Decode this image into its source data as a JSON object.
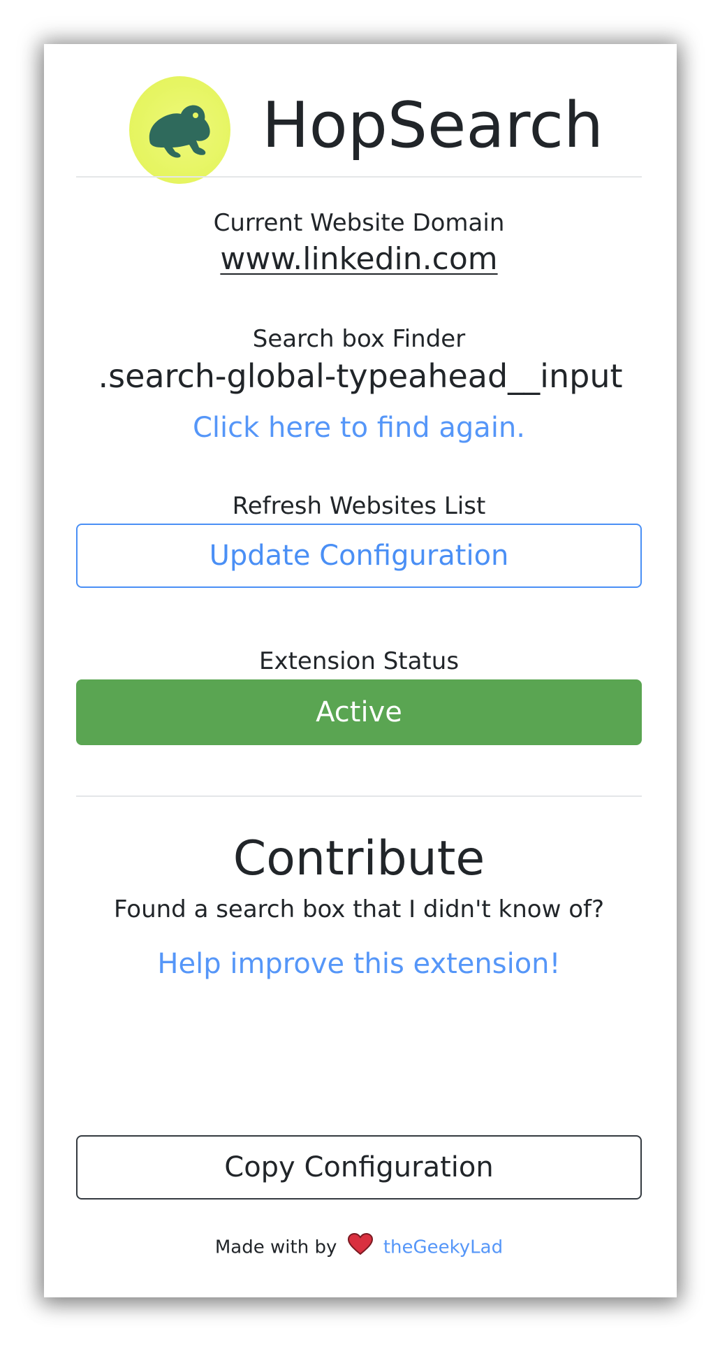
{
  "header": {
    "logo_icon": "frog-icon",
    "title": "HopSearch"
  },
  "domain": {
    "label": "Current Website Domain",
    "value": "www.linkedin.com"
  },
  "finder": {
    "label": "Search box Finder",
    "value": ".search-global-typeahead__input",
    "find_again_link": "Click here to find again."
  },
  "refresh": {
    "label": "Refresh Websites List",
    "button_label": "Update Configuration"
  },
  "status": {
    "label": "Extension Status",
    "value": "Active",
    "color": "#5aa552"
  },
  "contribute": {
    "heading": "Contribute",
    "prompt": "Found a search box that I didn't know of?",
    "help_link": "Help improve this extension!",
    "copy_button_label": "Copy Configuration"
  },
  "footer": {
    "made_with": "Made with",
    "by": "by",
    "heart_icon": "heart-icon",
    "author": "theGeekyLad"
  },
  "colors": {
    "accent_link": "#5596f8",
    "primary_border": "#4a8ff5",
    "logo_background": "#e6f563",
    "logo_frog": "#2f6a5c",
    "heart": "#d9303f"
  }
}
